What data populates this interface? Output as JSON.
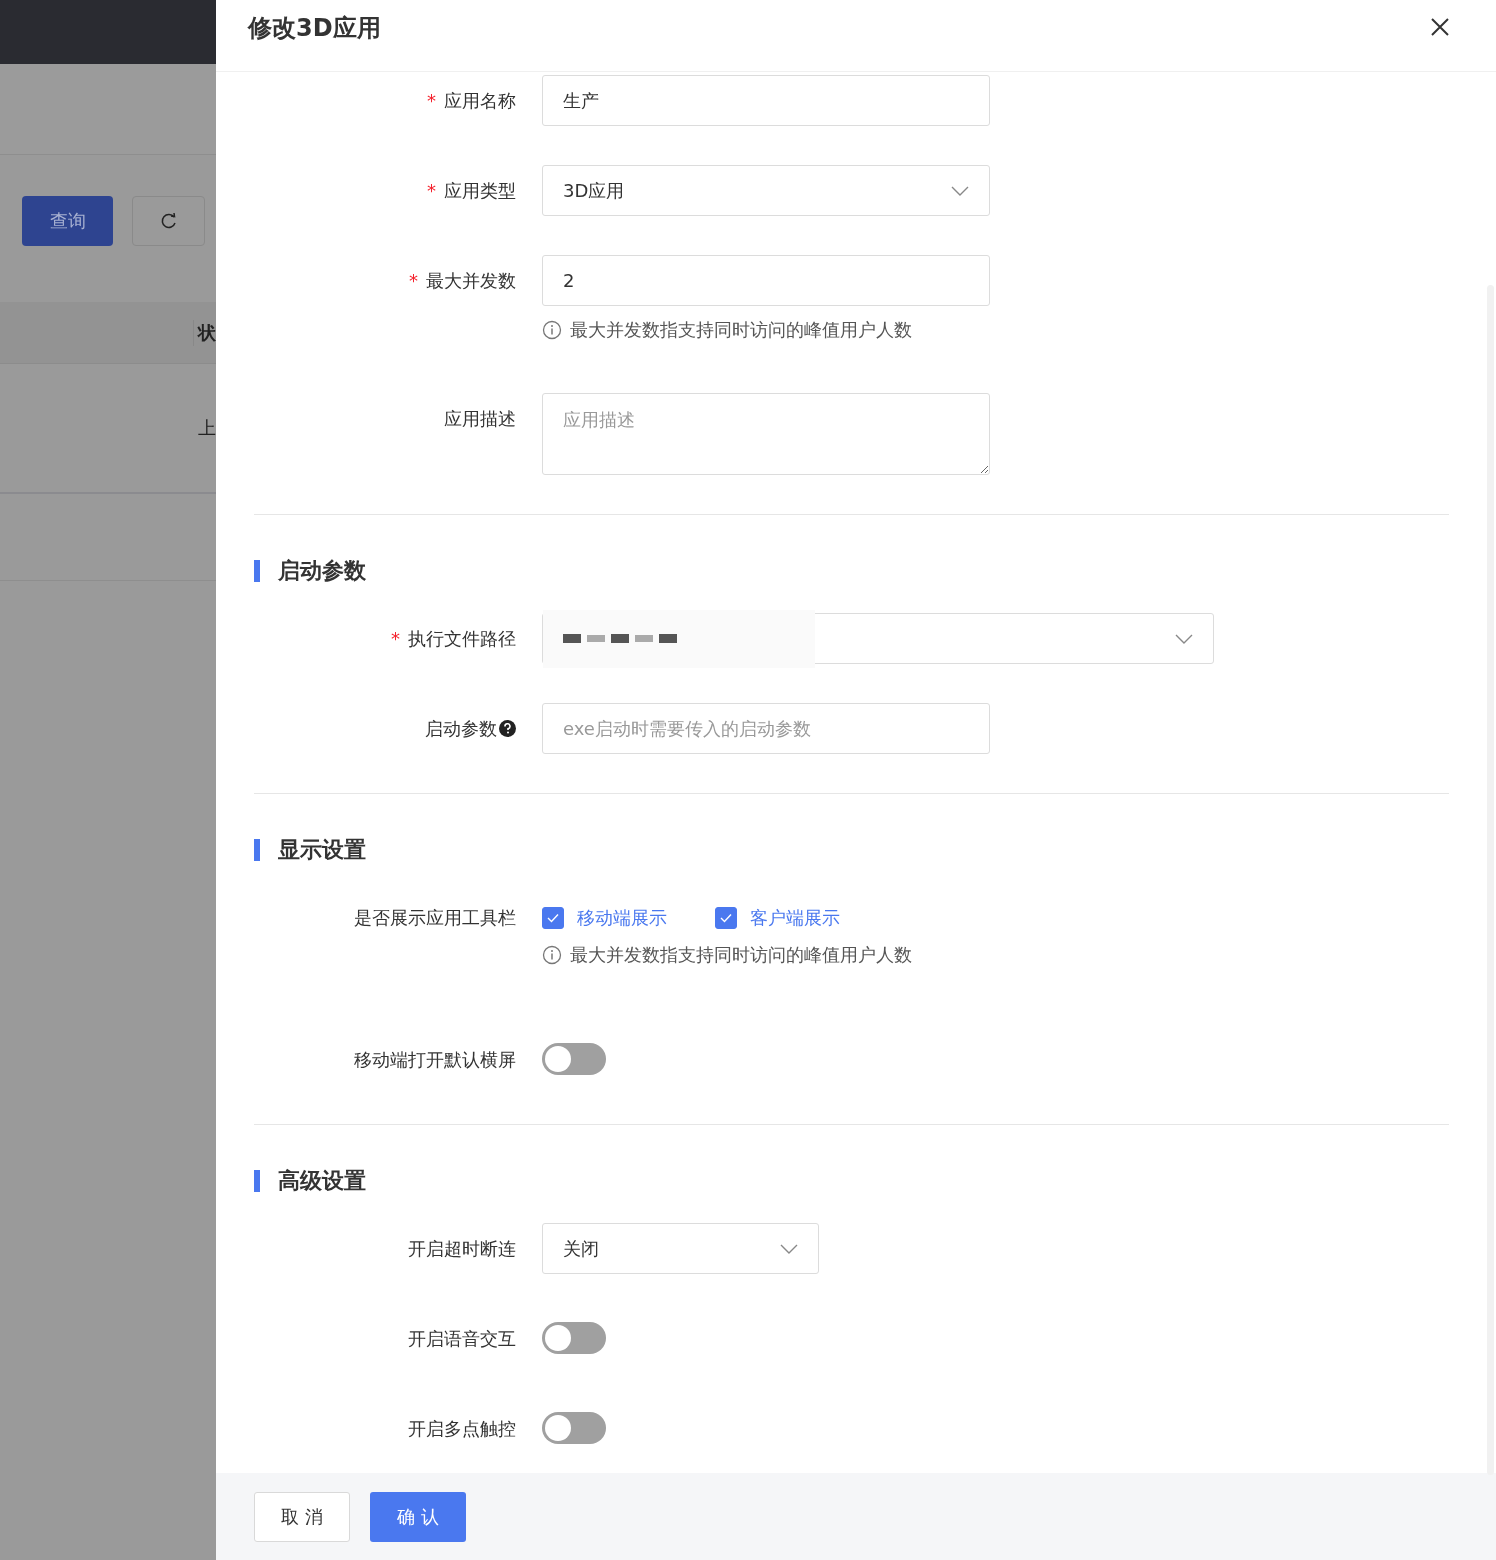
{
  "background": {
    "query_button": "查询",
    "table_header": "状",
    "table_cell": "上"
  },
  "drawer": {
    "title": "修改3D应用",
    "basic": [
      {
        "kind": "input",
        "required_mark": "*",
        "label": "应用名称",
        "value": "生产"
      },
      {
        "kind": "select",
        "required_mark": "*",
        "label": "应用类型",
        "value": "3D应用"
      },
      {
        "kind": "input",
        "required_mark": "*",
        "label": "最大并发数",
        "value": "2",
        "hint": "最大并发数指支持同时访问的峰值用户人数"
      },
      {
        "kind": "textarea",
        "label": "应用描述",
        "placeholder": "应用描述"
      }
    ],
    "sections": [
      {
        "title": "启动参数",
        "items": [
          {
            "kind": "select",
            "required_mark": "*",
            "label": "执行文件路径",
            "redacted": true,
            "wide": true
          },
          {
            "kind": "input",
            "label": "启动参数",
            "help": true,
            "placeholder": "exe启动时需要传入的启动参数"
          }
        ]
      },
      {
        "title": "显示设置",
        "items": [
          {
            "kind": "checkboxes",
            "label": "是否展示应用工具栏",
            "options": [
              {
                "label": "移动端展示",
                "checked": true
              },
              {
                "label": "客户端展示",
                "checked": true
              }
            ],
            "hint": "最大并发数指支持同时访问的峰值用户人数"
          },
          {
            "kind": "switch",
            "label": "移动端打开默认横屏",
            "on": false
          }
        ]
      },
      {
        "title": "高级设置",
        "items": [
          {
            "kind": "select",
            "label": "开启超时断连",
            "value": "关闭",
            "narrow": true
          },
          {
            "kind": "switch",
            "label": "开启语音交互",
            "on": false
          },
          {
            "kind": "switch",
            "label": "开启多点触控",
            "on": false
          }
        ]
      }
    ],
    "buttons": {
      "cancel": "取 消",
      "confirm": "确 认"
    }
  }
}
